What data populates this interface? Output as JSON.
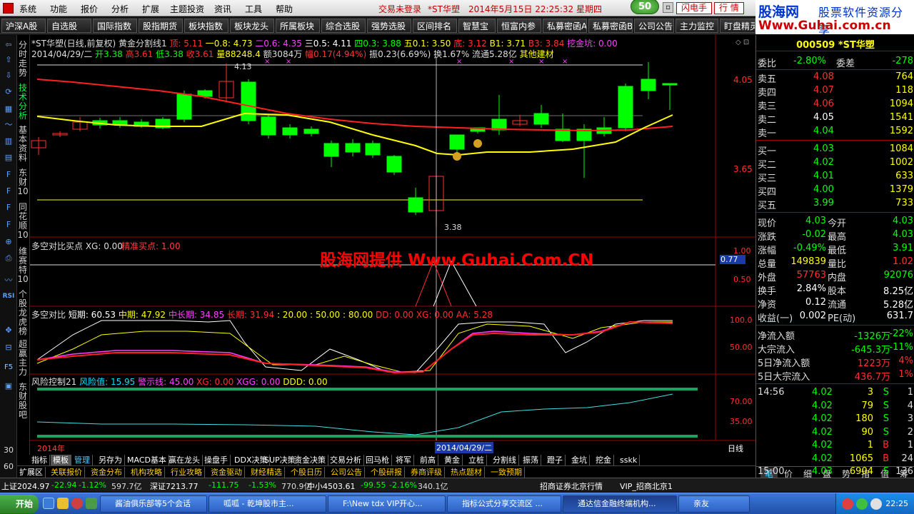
{
  "menu": {
    "items": [
      "系统",
      "功能",
      "报价",
      "分析",
      "扩展",
      "主题投资",
      "资讯",
      "工具",
      "帮助"
    ],
    "status_login": "交易未登录",
    "status_stock": "*ST华塑",
    "status_datetime": "2014年5月15日  22:25:32  星期四",
    "badge": "50",
    "btn_flash": "闪电手",
    "btn_quote": "行  情"
  },
  "brand": {
    "name": "股海网",
    "slogan": "股票软件资源分享",
    "url": "Www.Guhai.com.cn"
  },
  "toolbar": [
    "沪深A股",
    "自选股",
    "国际指数",
    "股指期货",
    "板块指数",
    "板块龙头",
    "所属板块",
    "综合选股",
    "强势选股",
    "区间排名",
    "智慧宝",
    "恒富内参",
    "私募密函A",
    "私募密函B",
    "公司公告",
    "主力监控",
    "盯盘精灵"
  ],
  "left_tabs": [
    "分时走势",
    "技术分析",
    "基本资料",
    "东财10",
    "同花顺10",
    "维赛特10",
    "个股龙虎榜",
    "超赢主力",
    "东财股吧"
  ],
  "left_icons": [
    "back-icon",
    "up-icon",
    "down-icon",
    "refresh-icon",
    "grid-icon",
    "line-icon",
    "bar-icon",
    "bar2-icon",
    "f10-icon",
    "f11-icon",
    "f12-icon",
    "f13-icon",
    "zoom-icon",
    "print-icon",
    "ind-icon",
    "rsi-icon",
    "cross-icon",
    "minus-icon",
    "f5-icon",
    "win-icon"
  ],
  "left_numbers": [
    "30",
    "60"
  ],
  "chart": {
    "info_line1": "*ST华塑(日线,前复权) 黄金分割线1",
    "info_golden": [
      {
        "label": "顶: 5.11",
        "color": "#ff3030"
      },
      {
        "label": "一0.8: 4.73",
        "color": "#ffff00"
      },
      {
        "label": "二0.6: 4.35",
        "color": "#ff40ff"
      },
      {
        "label": "三0.5: 4.11",
        "color": "#ffffff"
      },
      {
        "label": "四0.3: 3.88",
        "color": "#00ff00"
      },
      {
        "label": "五0.1: 3.50",
        "color": "#ffff00"
      },
      {
        "label": "底: 3.12",
        "color": "#ff3030"
      },
      {
        "label": "B1: 3.71",
        "color": "#ffff00"
      },
      {
        "label": "B3: 3.84",
        "color": "#ff3030"
      },
      {
        "label": "挖金坑: 0.00",
        "color": "#ff40ff"
      }
    ],
    "info_line2": [
      {
        "label": "2014/04/29/二",
        "color": "#dddddd"
      },
      {
        "label": "开3.38",
        "color": "#00ff00"
      },
      {
        "label": "高3.61",
        "color": "#ff3030"
      },
      {
        "label": "低3.38",
        "color": "#00ff00"
      },
      {
        "label": "收3.61",
        "color": "#ff3030"
      },
      {
        "label": "量88248.4",
        "color": "#ffff00"
      },
      {
        "label": "额3084万",
        "color": "#dddddd"
      },
      {
        "label": "幅0.17(4.94%)",
        "color": "#ff3030"
      },
      {
        "label": "振0.23(6.69%)",
        "color": "#dddddd"
      },
      {
        "label": "换1.67%",
        "color": "#dddddd"
      },
      {
        "label": "流通5.28亿",
        "color": "#dddddd"
      },
      {
        "label": "其他建材",
        "color": "#ffff00"
      }
    ],
    "price_axis": [
      "4.05",
      "3.65"
    ],
    "annotation_high": "4.13",
    "annotation_low": "3.38",
    "panel2_title": "多空对比买点 XG: 0.00",
    "panel2_label": "精准买点: 1.00",
    "panel2_axis": [
      "1.00",
      "0.77",
      "0.50"
    ],
    "panel3": [
      {
        "label": "多空对比",
        "color": "#dddddd"
      },
      {
        "label": "短期: 60.53",
        "color": "#ffffff"
      },
      {
        "label": "中期: 47.92",
        "color": "#ffff00"
      },
      {
        "label": "中长期: 34.85",
        "color": "#ff40ff"
      },
      {
        "label": "长期: 31.94",
        "color": "#ff3030"
      },
      {
        "label": ": 20.00",
        "color": "#ffff00"
      },
      {
        "label": ": 50.00",
        "color": "#ffff00"
      },
      {
        "label": ": 80.00",
        "color": "#ffff00"
      },
      {
        "label": "DD: 0.00",
        "color": "#ff3030"
      },
      {
        "label": "XG: 0.00",
        "color": "#ff3030"
      },
      {
        "label": "AA: 5.28",
        "color": "#ff3030"
      }
    ],
    "panel3_axis": [
      "100.0",
      "50.00"
    ],
    "panel4": [
      {
        "label": "风险控制21",
        "color": "#dddddd"
      },
      {
        "label": "风险值: 15.95",
        "color": "#00e0ff"
      },
      {
        "label": "警示线: 45.00",
        "color": "#ff40ff"
      },
      {
        "label": "XG: 0.00",
        "color": "#ff3030"
      },
      {
        "label": "XGG: 0.00",
        "color": "#ff40ff"
      },
      {
        "label": "DDD: 0.00",
        "color": "#ffff00"
      }
    ],
    "panel4_axis": [
      "70.00",
      "35.00"
    ],
    "year_label": "2014年",
    "cursor_date": "2014/04/29/二",
    "period": "日线",
    "watermark": "股海网提供 Www.Guhai.Com.CN"
  },
  "bottom_tabs": [
    "指标",
    "模板",
    "管理",
    "另存为",
    "MACD基本",
    "赢在龙头",
    "操盘手",
    "DDX决策",
    "SUP决策",
    "资金决策",
    "交易分析",
    "回马枪",
    "将军",
    "前高",
    "黄金",
    "立桩",
    "分割线",
    "振荡",
    "蹬子",
    "金坑",
    "挖金",
    "sskk"
  ],
  "bottom_tabs2": [
    "扩展区",
    "关联报价",
    "资金分布",
    "机构攻略",
    "行业攻略",
    "资金驱动",
    "财经精选",
    "个股日历",
    "公司公告",
    "个股研报",
    "券商评级",
    "热点题材",
    "一致预期"
  ],
  "quote": {
    "code_name": "000509 *ST华塑",
    "weibi_label": "委比",
    "weibi": "-2.80%",
    "weicha_label": "委差",
    "weicha": "-278",
    "sell": [
      {
        "label": "卖五",
        "price": "4.08",
        "vol": "764"
      },
      {
        "label": "卖四",
        "price": "4.07",
        "vol": "118"
      },
      {
        "label": "卖三",
        "price": "4.06",
        "vol": "1094"
      },
      {
        "label": "卖二",
        "price": "4.05",
        "vol": "1541"
      },
      {
        "label": "卖一",
        "price": "4.04",
        "vol": "1592"
      }
    ],
    "buy": [
      {
        "label": "买一",
        "price": "4.03",
        "vol": "1084"
      },
      {
        "label": "买二",
        "price": "4.02",
        "vol": "1002"
      },
      {
        "label": "买三",
        "price": "4.01",
        "vol": "633"
      },
      {
        "label": "买四",
        "price": "4.00",
        "vol": "1379"
      },
      {
        "label": "买五",
        "price": "3.99",
        "vol": "733"
      }
    ],
    "stats": [
      {
        "l1": "现价",
        "v1": "4.03",
        "c1": "#00ff00",
        "l2": "今开",
        "v2": "4.03",
        "c2": "#00ff00"
      },
      {
        "l1": "涨跌",
        "v1": "-0.02",
        "c1": "#00ff00",
        "l2": "最高",
        "v2": "4.03",
        "c2": "#00ff00"
      },
      {
        "l1": "涨幅",
        "v1": "-0.49%",
        "c1": "#00ff00",
        "l2": "最低",
        "v2": "3.91",
        "c2": "#00ff00"
      },
      {
        "l1": "总量",
        "v1": "149839",
        "c1": "#ffff00",
        "l2": "量比",
        "v2": "1.02",
        "c2": "#ff3030"
      },
      {
        "l1": "外盘",
        "v1": "57763",
        "c1": "#ff3030",
        "l2": "内盘",
        "v2": "92076",
        "c2": "#00ff00"
      },
      {
        "l1": "换手",
        "v1": "2.84%",
        "c1": "#ffffff",
        "l2": "股本",
        "v2": "8.25亿",
        "c2": "#ffffff"
      },
      {
        "l1": "净资",
        "v1": "0.12",
        "c1": "#ffffff",
        "l2": "流通",
        "v2": "5.28亿",
        "c2": "#ffffff"
      },
      {
        "l1": "收益(一)",
        "v1": "0.002",
        "c1": "#ffffff",
        "l2": "PE(动)",
        "v2": "631.7",
        "c2": "#ffffff"
      }
    ],
    "flows": [
      {
        "label": "净流入额",
        "value": "-1326万",
        "pct": "-22%",
        "color": "#00ff00"
      },
      {
        "label": "大宗流入",
        "value": "-645.3万",
        "pct": "-11%",
        "color": "#00ff00"
      },
      {
        "label": "5日净流入额",
        "value": "1223万",
        "pct": "4%",
        "color": "#ff3030"
      },
      {
        "label": "5日大宗流入",
        "value": "436.7万",
        "pct": "1%",
        "color": "#ff3030"
      }
    ],
    "ticks": [
      {
        "time": "14:56",
        "price": "4.02",
        "vol": "3",
        "side": "S",
        "n": "1"
      },
      {
        "time": "",
        "price": "4.02",
        "vol": "79",
        "side": "S",
        "n": "4"
      },
      {
        "time": "",
        "price": "4.02",
        "vol": "180",
        "side": "S",
        "n": "3"
      },
      {
        "time": "",
        "price": "4.02",
        "vol": "90",
        "side": "S",
        "n": "2"
      },
      {
        "time": "",
        "price": "4.02",
        "vol": "1",
        "side": "B",
        "n": "1"
      },
      {
        "time": "",
        "price": "4.02",
        "vol": "1065",
        "side": "B",
        "n": "24"
      },
      {
        "time": "15:00",
        "price": "4.03",
        "vol": "6904",
        "side": "S",
        "n": "136"
      }
    ],
    "bottom_tabs": [
      "笔",
      "价",
      "细",
      "盘",
      "势",
      "指",
      "值",
      "筹"
    ]
  },
  "statusbar": [
    {
      "label": "上证2024.97",
      "color": "#ffffff"
    },
    {
      "label": "-22.94",
      "color": "#00ff00"
    },
    {
      "label": "-1.12%",
      "color": "#00ff00"
    },
    {
      "label": "597.7亿",
      "color": "#dddddd"
    },
    {
      "label": "深证7213.77",
      "color": "#ffffff"
    },
    {
      "label": "-111.75",
      "color": "#00ff00"
    },
    {
      "label": "-1.53%",
      "color": "#00ff00"
    },
    {
      "label": "770.9亿",
      "color": "#dddddd"
    },
    {
      "label": "中小4503.61",
      "color": "#ffffff"
    },
    {
      "label": "-99.55",
      "color": "#00ff00"
    },
    {
      "label": "-2.16%",
      "color": "#00ff00"
    },
    {
      "label": "340.1亿",
      "color": "#dddddd"
    },
    {
      "label": "招商证券北京行情",
      "color": "#ffffff"
    },
    {
      "label": "VIP_招商北京1",
      "color": "#ffffff"
    }
  ],
  "taskbar": {
    "start": "开始",
    "tasks": [
      "酱油俱乐部等5个会话",
      "呱呱 - 乾坤股市主...",
      "F:\\New tdx VIP开心...",
      "指标公式分享交流区 ...",
      "通达信金融终端机构...",
      "亲友"
    ],
    "clock": "22:25"
  }
}
